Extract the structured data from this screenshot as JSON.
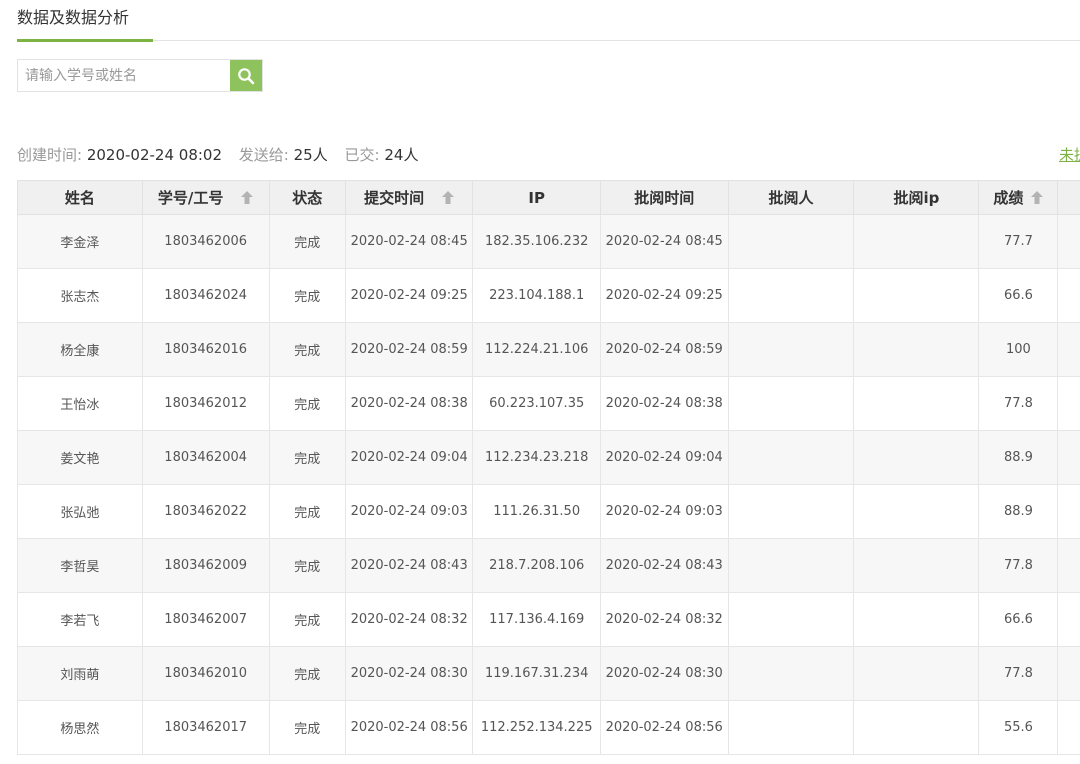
{
  "tab": {
    "title": "数据及数据分析"
  },
  "search": {
    "placeholder": "请输入学号或姓名",
    "value": ""
  },
  "meta": {
    "created_label": "创建时间:",
    "created_value": "2020-02-24 08:02",
    "sent_label": "发送给:",
    "sent_value": "25人",
    "submitted_label": "已交:",
    "submitted_value": "24人",
    "unsubmitted_link": "未提交"
  },
  "table": {
    "headers": {
      "name": "姓名",
      "id": "学号/工号",
      "status": "状态",
      "submit_time": "提交时间",
      "ip": "IP",
      "review_time": "批阅时间",
      "reviewer": "批阅人",
      "review_ip": "批阅ip",
      "score": "成绩"
    },
    "rows": [
      {
        "name": "李金泽",
        "id": "1803462006",
        "status": "完成",
        "submit_time": "2020-02-24 08:45",
        "ip": "182.35.106.232",
        "review_time": "2020-02-24 08:45",
        "reviewer": "",
        "review_ip": "",
        "score": "77.7"
      },
      {
        "name": "张志杰",
        "id": "1803462024",
        "status": "完成",
        "submit_time": "2020-02-24 09:25",
        "ip": "223.104.188.1",
        "review_time": "2020-02-24 09:25",
        "reviewer": "",
        "review_ip": "",
        "score": "66.6"
      },
      {
        "name": "杨全康",
        "id": "1803462016",
        "status": "完成",
        "submit_time": "2020-02-24 08:59",
        "ip": "112.224.21.106",
        "review_time": "2020-02-24 08:59",
        "reviewer": "",
        "review_ip": "",
        "score": "100"
      },
      {
        "name": "王怡冰",
        "id": "1803462012",
        "status": "完成",
        "submit_time": "2020-02-24 08:38",
        "ip": "60.223.107.35",
        "review_time": "2020-02-24 08:38",
        "reviewer": "",
        "review_ip": "",
        "score": "77.8"
      },
      {
        "name": "姜文艳",
        "id": "1803462004",
        "status": "完成",
        "submit_time": "2020-02-24 09:04",
        "ip": "112.234.23.218",
        "review_time": "2020-02-24 09:04",
        "reviewer": "",
        "review_ip": "",
        "score": "88.9"
      },
      {
        "name": "张弘弛",
        "id": "1803462022",
        "status": "完成",
        "submit_time": "2020-02-24 09:03",
        "ip": "111.26.31.50",
        "review_time": "2020-02-24 09:03",
        "reviewer": "",
        "review_ip": "",
        "score": "88.9"
      },
      {
        "name": "李哲昊",
        "id": "1803462009",
        "status": "完成",
        "submit_time": "2020-02-24 08:43",
        "ip": "218.7.208.106",
        "review_time": "2020-02-24 08:43",
        "reviewer": "",
        "review_ip": "",
        "score": "77.8"
      },
      {
        "name": "李若飞",
        "id": "1803462007",
        "status": "完成",
        "submit_time": "2020-02-24 08:32",
        "ip": "117.136.4.169",
        "review_time": "2020-02-24 08:32",
        "reviewer": "",
        "review_ip": "",
        "score": "66.6"
      },
      {
        "name": "刘雨萌",
        "id": "1803462010",
        "status": "完成",
        "submit_time": "2020-02-24 08:30",
        "ip": "119.167.31.234",
        "review_time": "2020-02-24 08:30",
        "reviewer": "",
        "review_ip": "",
        "score": "77.8"
      },
      {
        "name": "杨思然",
        "id": "1803462017",
        "status": "完成",
        "submit_time": "2020-02-24 08:56",
        "ip": "112.252.134.225",
        "review_time": "2020-02-24 08:56",
        "reviewer": "",
        "review_ip": "",
        "score": "55.6"
      }
    ]
  },
  "colors": {
    "accent": "#7cb342",
    "search_button": "#8ec25d",
    "header_bg": "#f0f0f0",
    "stripe_bg": "#f7f7f7"
  },
  "icons": {
    "search": "search-icon",
    "sort": "sort-up-arrow-icon"
  }
}
